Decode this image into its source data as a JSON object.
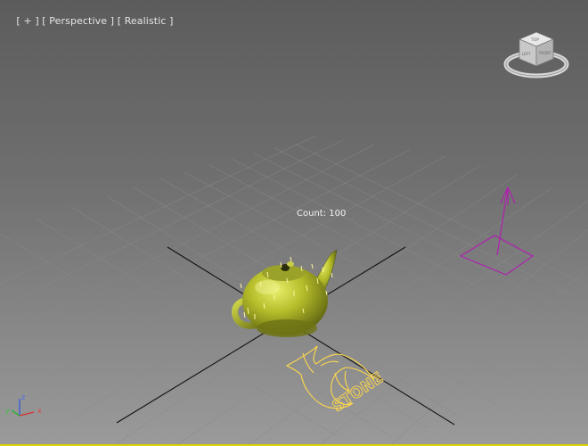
{
  "viewport": {
    "label_open": "[ ",
    "label_plus": "+",
    "label_mid1": " ] [ ",
    "label_view": "Perspective",
    "label_mid2": " ] [ ",
    "label_shading": "Realistic",
    "label_close": " ]",
    "count_text": "Count: 100"
  },
  "viewcube": {
    "face_top": "TOP",
    "face_left": "LEFT",
    "face_front": "FRONT"
  },
  "axes": {
    "x": "x",
    "y": "y",
    "z": "z"
  },
  "logo_text": "STONE",
  "colors": {
    "teapot": "#b5bd2a",
    "selection_border": "#d9d400",
    "grid_major": "#111111",
    "grid_minor": "#8a8a8a",
    "spline": "#ffd84a",
    "wind_gizmo": "#b020b0"
  },
  "icons": {
    "viewcube": "viewcube-icon",
    "axis": "axis-tripod-icon"
  }
}
